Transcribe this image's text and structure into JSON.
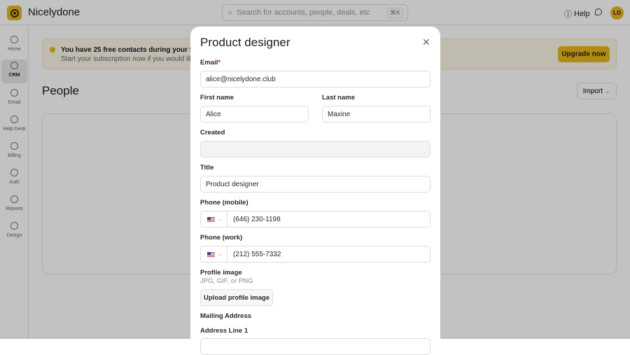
{
  "app": {
    "name": "Nicelydone",
    "search_placeholder": "Search for accounts, people, deals, etc",
    "search_shortcut": "⌘K",
    "help": "Help",
    "avatar": "LO"
  },
  "sidebar": {
    "items": [
      {
        "label": "Home"
      },
      {
        "label": "CRM",
        "active": true
      },
      {
        "label": "Email"
      },
      {
        "label": "Help Desk"
      },
      {
        "label": "Billing"
      },
      {
        "label": "Auth"
      },
      {
        "label": "Reports"
      },
      {
        "label": "Design"
      }
    ]
  },
  "banner": {
    "line1": "You have 25 free contacts during your free trial",
    "line2": "Start your subscription now if you would like to l",
    "button": "Upgrade now"
  },
  "page": {
    "title": "People",
    "import": "Import"
  },
  "modal": {
    "title": "Product designer",
    "email_label": "Email",
    "required": "*",
    "email": "alice@nicelydone.club",
    "first_name_label": "First name",
    "first_name": "Alice",
    "last_name_label": "Last name",
    "last_name": "Maxine",
    "created_label": "Created",
    "created": "",
    "title_label": "Title",
    "phone_mobile_label": "Phone (mobile)",
    "phone_mobile": "(646) 230-1198",
    "phone_work_label": "Phone (work)",
    "phone_work": "(212) 555-7332",
    "profile_label": "Profile image",
    "profile_hint": "JPG, GIF, or PNG",
    "upload": "Upload profile image",
    "mailing_label": "Mailing Address",
    "address1_label": "Address Line 1"
  }
}
